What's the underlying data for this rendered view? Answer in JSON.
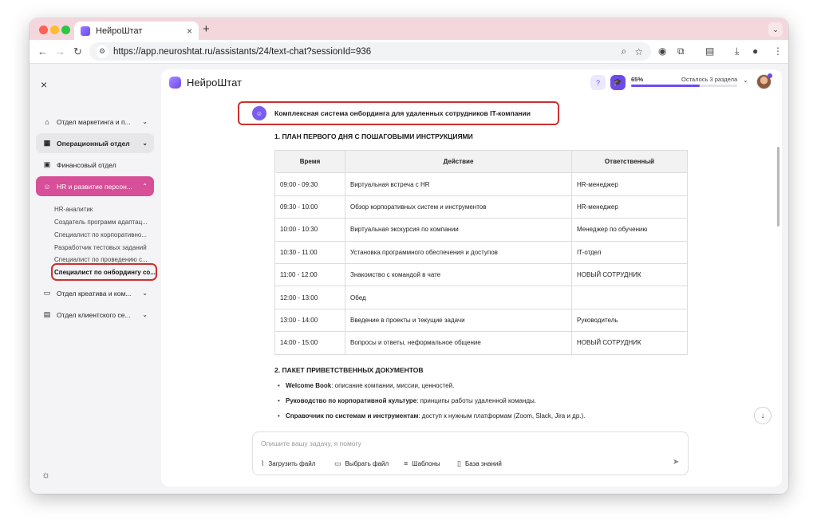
{
  "browser": {
    "tab_title": "НейроШтат",
    "tab_close": "×",
    "new_tab": "+",
    "url": "https://app.neuroshtat.ru/assistants/24/text-chat?sessionId=936",
    "icons": [
      "back-icon",
      "forward-icon",
      "reload-icon",
      "site-info-icon",
      "zoom-icon",
      "bookmark-star-icon",
      "extension-icon",
      "puzzle-icon",
      "reading-list-icon",
      "download-icon",
      "profile-icon",
      "menu-icon"
    ]
  },
  "sidebar": {
    "close_glyph": "×",
    "items": [
      {
        "label": "Отдел маркетинга и п...",
        "icon": "building-icon"
      },
      {
        "label": "Операционный отдел",
        "icon": "grid-icon"
      },
      {
        "label": "Финансовый отдел",
        "icon": "wallet-icon"
      },
      {
        "label": "HR и развитие персон...",
        "icon": "people-icon"
      },
      {
        "label": "Отдел креатива и ком...",
        "icon": "chat-icon"
      },
      {
        "label": "Отдел клиентского се...",
        "icon": "id-card-icon"
      }
    ],
    "sub_items": [
      "HR-аналитик",
      "Создатель программ адаптац...",
      "Специалист по корпоративно...",
      "Разработчик тестовых заданий",
      "Специалист по проведению с...",
      "Специалист по онбордингу со..."
    ],
    "theme_icon": "sun-icon"
  },
  "header": {
    "brand": "НейроШтат",
    "progress_pct": "65%",
    "progress_value": 0.65,
    "progress_rest": "Осталось 3 раздела"
  },
  "chat": {
    "assistant_title": "Комплексная система онбординга для удаленных сотрудников IT-компании",
    "section1": "1. ПЛАН ПЕРВОГО ДНЯ С ПОШАГОВЫМИ ИНСТРУКЦИЯМИ",
    "table": {
      "headers": [
        "Время",
        "Действие",
        "Ответственный"
      ],
      "rows": [
        [
          "09:00 - 09:30",
          "Виртуальная встреча с HR",
          "HR-менеджер"
        ],
        [
          "09:30 - 10:00",
          "Обзор корпоративных систем и инструментов",
          "HR-менеджер"
        ],
        [
          "10:00 - 10:30",
          "Виртуальная экскурсия по компании",
          "Менеджер по обучению"
        ],
        [
          "10:30 - 11:00",
          "Установка программного обеспечения и доступов",
          "IT-отдел"
        ],
        [
          "11:00 - 12:00",
          "Знакомство с командой в чате",
          "НОВЫЙ СОТРУДНИК"
        ],
        [
          "12:00 - 13:00",
          "Обед",
          ""
        ],
        [
          "13:00 - 14:00",
          "Введение в проекты и текущие задачи",
          "Руководитель"
        ],
        [
          "14:00 - 15:00",
          "Вопросы и ответы, неформальное общение",
          "НОВЫЙ СОТРУДНИК"
        ]
      ]
    },
    "section2": "2. ПАКЕТ ПРИВЕТСТВЕННЫХ ДОКУМЕНТОВ",
    "bullets": [
      {
        "strong": "Welcome Book",
        "rest": ": описание компании, миссии, ценностей."
      },
      {
        "strong": "Руководство по корпоративной культуре",
        "rest": ": принципы работы удаленной команды."
      },
      {
        "strong": "Справочник по системам и инструментам",
        "rest": ": доступ к нужным платформам (Zoom, Slack, Jira и др.)."
      }
    ]
  },
  "composer": {
    "placeholder": "Опишите вашу задачу, я помогу",
    "tools": [
      "Загрузить файл",
      "Выбрать файл",
      "Шаблоны",
      "База знаний"
    ]
  }
}
